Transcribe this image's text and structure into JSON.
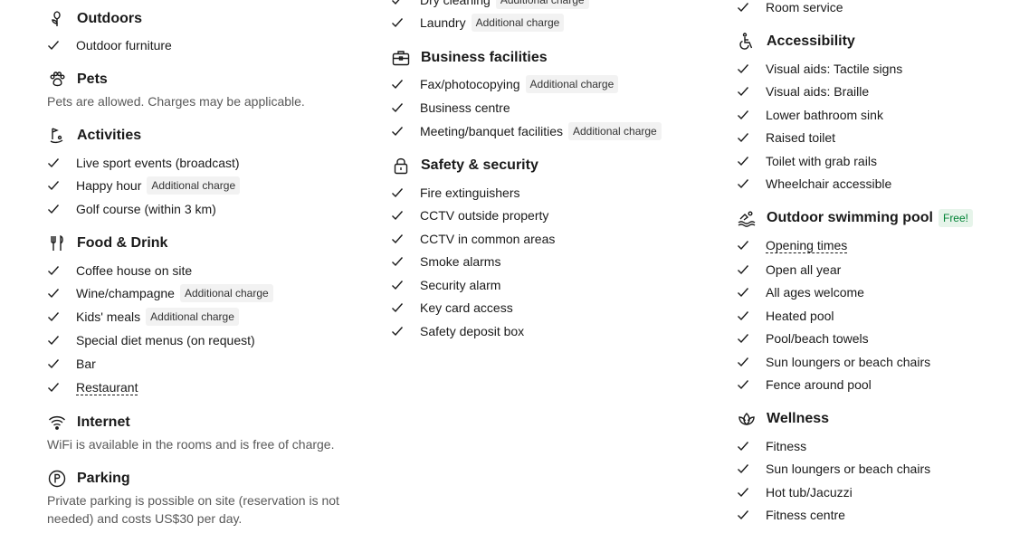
{
  "col1": {
    "outdoors": {
      "title": "Outdoors",
      "items": [
        "Outdoor furniture"
      ]
    },
    "pets": {
      "title": "Pets",
      "desc": "Pets are allowed. Charges may be applicable."
    },
    "activities": {
      "title": "Activities",
      "items": [
        "Live sport events (broadcast)",
        "Happy hour",
        "Golf course (within 3 km)"
      ],
      "happy_hour_badge": "Additional charge"
    },
    "food": {
      "title": "Food & Drink",
      "items": [
        "Coffee house on site",
        "Wine/champagne",
        "Kids' meals",
        "Special diet menus (on request)",
        "Bar",
        "Restaurant"
      ],
      "wine_badge": "Additional charge",
      "kids_badge": "Additional charge"
    },
    "internet": {
      "title": "Internet",
      "desc": "WiFi is available in the rooms and is free of charge."
    },
    "parking": {
      "title": "Parking",
      "desc": "Private parking is possible on site (reservation is not needed) and costs US$30 per day."
    }
  },
  "col2": {
    "services_tail": {
      "items": [
        "Dry cleaning",
        "Laundry"
      ],
      "dry_badge": "Additional charge",
      "laundry_badge": "Additional charge"
    },
    "business": {
      "title": "Business facilities",
      "items": [
        "Fax/photocopying",
        "Business centre",
        "Meeting/banquet facilities"
      ],
      "fax_badge": "Additional charge",
      "meeting_badge": "Additional charge"
    },
    "safety": {
      "title": "Safety & security",
      "items": [
        "Fire extinguishers",
        "CCTV outside property",
        "CCTV in common areas",
        "Smoke alarms",
        "Security alarm",
        "Key card access",
        "Safety deposit box"
      ]
    }
  },
  "col3": {
    "room_tail": {
      "items": [
        "Room service"
      ]
    },
    "accessibility": {
      "title": "Accessibility",
      "items": [
        "Visual aids: Tactile signs",
        "Visual aids: Braille",
        "Lower bathroom sink",
        "Raised toilet",
        "Toilet with grab rails",
        "Wheelchair accessible"
      ]
    },
    "pool": {
      "title": "Outdoor swimming pool",
      "badge": "Free!",
      "items": [
        "Opening times",
        "Open all year",
        "All ages welcome",
        "Heated pool",
        "Pool/beach towels",
        "Sun loungers or beach chairs",
        "Fence around pool"
      ]
    },
    "wellness": {
      "title": "Wellness",
      "items": [
        "Fitness",
        "Sun loungers or beach chairs",
        "Hot tub/Jacuzzi",
        "Fitness centre"
      ]
    }
  }
}
